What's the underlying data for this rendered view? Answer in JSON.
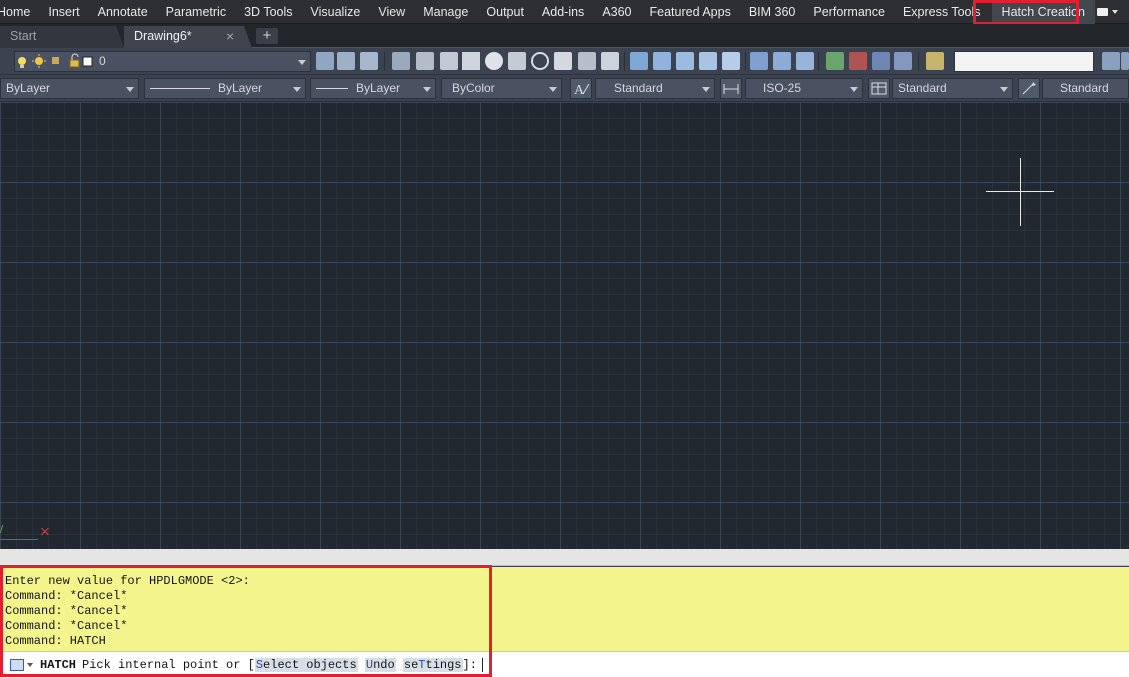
{
  "ribbon": {
    "tabs": [
      "Home",
      "Insert",
      "Annotate",
      "Parametric",
      "3D Tools",
      "Visualize",
      "View",
      "Manage",
      "Output",
      "Add-ins",
      "A360",
      "Featured Apps",
      "BIM 360",
      "Performance",
      "Express Tools"
    ],
    "active_tab": "Hatch Creation",
    "highlight_color": "#e02030"
  },
  "file_tabs": {
    "start": "Start",
    "drawing": "Drawing6*",
    "close_glyph": "×",
    "add_glyph": "+"
  },
  "layer": {
    "current": "0"
  },
  "properties": {
    "color": "ByLayer",
    "linetype": "ByLayer",
    "lineweight": "ByLayer",
    "plotstyle": "ByColor",
    "text_style": "Standard",
    "dim_style": "ISO-25",
    "table_style": "Standard",
    "mleader_style": "Standard"
  },
  "command": {
    "history": [
      "Enter new value for HPDLGMODE <2>:",
      "Command: *Cancel*",
      "Command: *Cancel*",
      "Command: *Cancel*",
      "Command: HATCH"
    ],
    "active_command": "HATCH",
    "prompt_text": "Pick internal point or [",
    "options": [
      {
        "pre": "",
        "hot": "S",
        "post": "elect objects"
      },
      {
        "pre": "",
        "hot": "U",
        "post": "ndo"
      },
      {
        "pre": "se",
        "hot": "T",
        "post": "tings"
      }
    ],
    "prompt_end": "]:"
  },
  "colors": {
    "canvas": "#212830",
    "command_bg": "#f3f58c",
    "ucs_x": "#d23b3b"
  }
}
